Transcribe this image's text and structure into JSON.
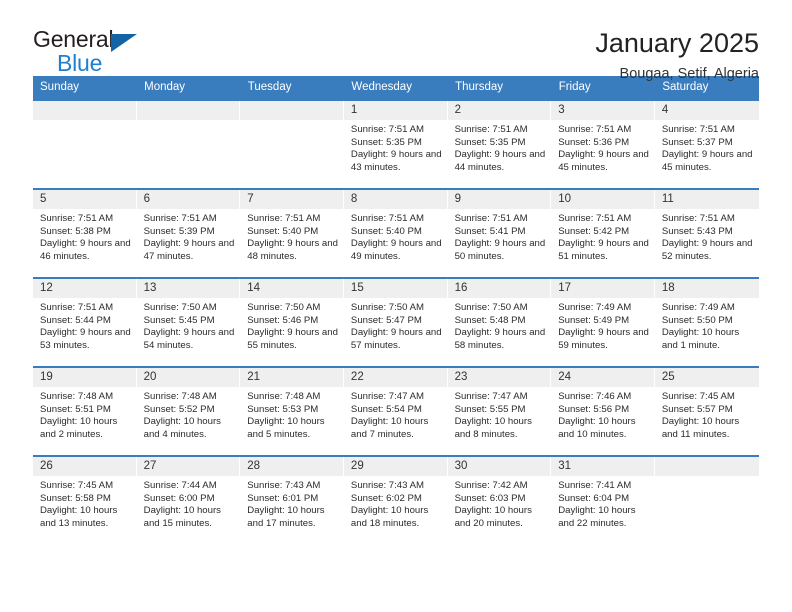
{
  "brand": {
    "name_part1": "General",
    "name_part2": "Blue",
    "flag_icon": "triangle-flag-icon",
    "accent_color": "#1f7fd0"
  },
  "header": {
    "title": "January 2025",
    "subtitle": "Bougaa, Setif, Algeria"
  },
  "calendar": {
    "header_bg": "#3a7dbf",
    "daynum_bg": "#efefef",
    "weekday_headers": [
      "Sunday",
      "Monday",
      "Tuesday",
      "Wednesday",
      "Thursday",
      "Friday",
      "Saturday"
    ],
    "weeks": [
      [
        {
          "day": "",
          "sunrise": "",
          "sunset": "",
          "daylight": ""
        },
        {
          "day": "",
          "sunrise": "",
          "sunset": "",
          "daylight": ""
        },
        {
          "day": "",
          "sunrise": "",
          "sunset": "",
          "daylight": ""
        },
        {
          "day": "1",
          "sunrise": "Sunrise: 7:51 AM",
          "sunset": "Sunset: 5:35 PM",
          "daylight": "Daylight: 9 hours and 43 minutes."
        },
        {
          "day": "2",
          "sunrise": "Sunrise: 7:51 AM",
          "sunset": "Sunset: 5:35 PM",
          "daylight": "Daylight: 9 hours and 44 minutes."
        },
        {
          "day": "3",
          "sunrise": "Sunrise: 7:51 AM",
          "sunset": "Sunset: 5:36 PM",
          "daylight": "Daylight: 9 hours and 45 minutes."
        },
        {
          "day": "4",
          "sunrise": "Sunrise: 7:51 AM",
          "sunset": "Sunset: 5:37 PM",
          "daylight": "Daylight: 9 hours and 45 minutes."
        }
      ],
      [
        {
          "day": "5",
          "sunrise": "Sunrise: 7:51 AM",
          "sunset": "Sunset: 5:38 PM",
          "daylight": "Daylight: 9 hours and 46 minutes."
        },
        {
          "day": "6",
          "sunrise": "Sunrise: 7:51 AM",
          "sunset": "Sunset: 5:39 PM",
          "daylight": "Daylight: 9 hours and 47 minutes."
        },
        {
          "day": "7",
          "sunrise": "Sunrise: 7:51 AM",
          "sunset": "Sunset: 5:40 PM",
          "daylight": "Daylight: 9 hours and 48 minutes."
        },
        {
          "day": "8",
          "sunrise": "Sunrise: 7:51 AM",
          "sunset": "Sunset: 5:40 PM",
          "daylight": "Daylight: 9 hours and 49 minutes."
        },
        {
          "day": "9",
          "sunrise": "Sunrise: 7:51 AM",
          "sunset": "Sunset: 5:41 PM",
          "daylight": "Daylight: 9 hours and 50 minutes."
        },
        {
          "day": "10",
          "sunrise": "Sunrise: 7:51 AM",
          "sunset": "Sunset: 5:42 PM",
          "daylight": "Daylight: 9 hours and 51 minutes."
        },
        {
          "day": "11",
          "sunrise": "Sunrise: 7:51 AM",
          "sunset": "Sunset: 5:43 PM",
          "daylight": "Daylight: 9 hours and 52 minutes."
        }
      ],
      [
        {
          "day": "12",
          "sunrise": "Sunrise: 7:51 AM",
          "sunset": "Sunset: 5:44 PM",
          "daylight": "Daylight: 9 hours and 53 minutes."
        },
        {
          "day": "13",
          "sunrise": "Sunrise: 7:50 AM",
          "sunset": "Sunset: 5:45 PM",
          "daylight": "Daylight: 9 hours and 54 minutes."
        },
        {
          "day": "14",
          "sunrise": "Sunrise: 7:50 AM",
          "sunset": "Sunset: 5:46 PM",
          "daylight": "Daylight: 9 hours and 55 minutes."
        },
        {
          "day": "15",
          "sunrise": "Sunrise: 7:50 AM",
          "sunset": "Sunset: 5:47 PM",
          "daylight": "Daylight: 9 hours and 57 minutes."
        },
        {
          "day": "16",
          "sunrise": "Sunrise: 7:50 AM",
          "sunset": "Sunset: 5:48 PM",
          "daylight": "Daylight: 9 hours and 58 minutes."
        },
        {
          "day": "17",
          "sunrise": "Sunrise: 7:49 AM",
          "sunset": "Sunset: 5:49 PM",
          "daylight": "Daylight: 9 hours and 59 minutes."
        },
        {
          "day": "18",
          "sunrise": "Sunrise: 7:49 AM",
          "sunset": "Sunset: 5:50 PM",
          "daylight": "Daylight: 10 hours and 1 minute."
        }
      ],
      [
        {
          "day": "19",
          "sunrise": "Sunrise: 7:48 AM",
          "sunset": "Sunset: 5:51 PM",
          "daylight": "Daylight: 10 hours and 2 minutes."
        },
        {
          "day": "20",
          "sunrise": "Sunrise: 7:48 AM",
          "sunset": "Sunset: 5:52 PM",
          "daylight": "Daylight: 10 hours and 4 minutes."
        },
        {
          "day": "21",
          "sunrise": "Sunrise: 7:48 AM",
          "sunset": "Sunset: 5:53 PM",
          "daylight": "Daylight: 10 hours and 5 minutes."
        },
        {
          "day": "22",
          "sunrise": "Sunrise: 7:47 AM",
          "sunset": "Sunset: 5:54 PM",
          "daylight": "Daylight: 10 hours and 7 minutes."
        },
        {
          "day": "23",
          "sunrise": "Sunrise: 7:47 AM",
          "sunset": "Sunset: 5:55 PM",
          "daylight": "Daylight: 10 hours and 8 minutes."
        },
        {
          "day": "24",
          "sunrise": "Sunrise: 7:46 AM",
          "sunset": "Sunset: 5:56 PM",
          "daylight": "Daylight: 10 hours and 10 minutes."
        },
        {
          "day": "25",
          "sunrise": "Sunrise: 7:45 AM",
          "sunset": "Sunset: 5:57 PM",
          "daylight": "Daylight: 10 hours and 11 minutes."
        }
      ],
      [
        {
          "day": "26",
          "sunrise": "Sunrise: 7:45 AM",
          "sunset": "Sunset: 5:58 PM",
          "daylight": "Daylight: 10 hours and 13 minutes."
        },
        {
          "day": "27",
          "sunrise": "Sunrise: 7:44 AM",
          "sunset": "Sunset: 6:00 PM",
          "daylight": "Daylight: 10 hours and 15 minutes."
        },
        {
          "day": "28",
          "sunrise": "Sunrise: 7:43 AM",
          "sunset": "Sunset: 6:01 PM",
          "daylight": "Daylight: 10 hours and 17 minutes."
        },
        {
          "day": "29",
          "sunrise": "Sunrise: 7:43 AM",
          "sunset": "Sunset: 6:02 PM",
          "daylight": "Daylight: 10 hours and 18 minutes."
        },
        {
          "day": "30",
          "sunrise": "Sunrise: 7:42 AM",
          "sunset": "Sunset: 6:03 PM",
          "daylight": "Daylight: 10 hours and 20 minutes."
        },
        {
          "day": "31",
          "sunrise": "Sunrise: 7:41 AM",
          "sunset": "Sunset: 6:04 PM",
          "daylight": "Daylight: 10 hours and 22 minutes."
        },
        {
          "day": "",
          "sunrise": "",
          "sunset": "",
          "daylight": ""
        }
      ]
    ]
  }
}
